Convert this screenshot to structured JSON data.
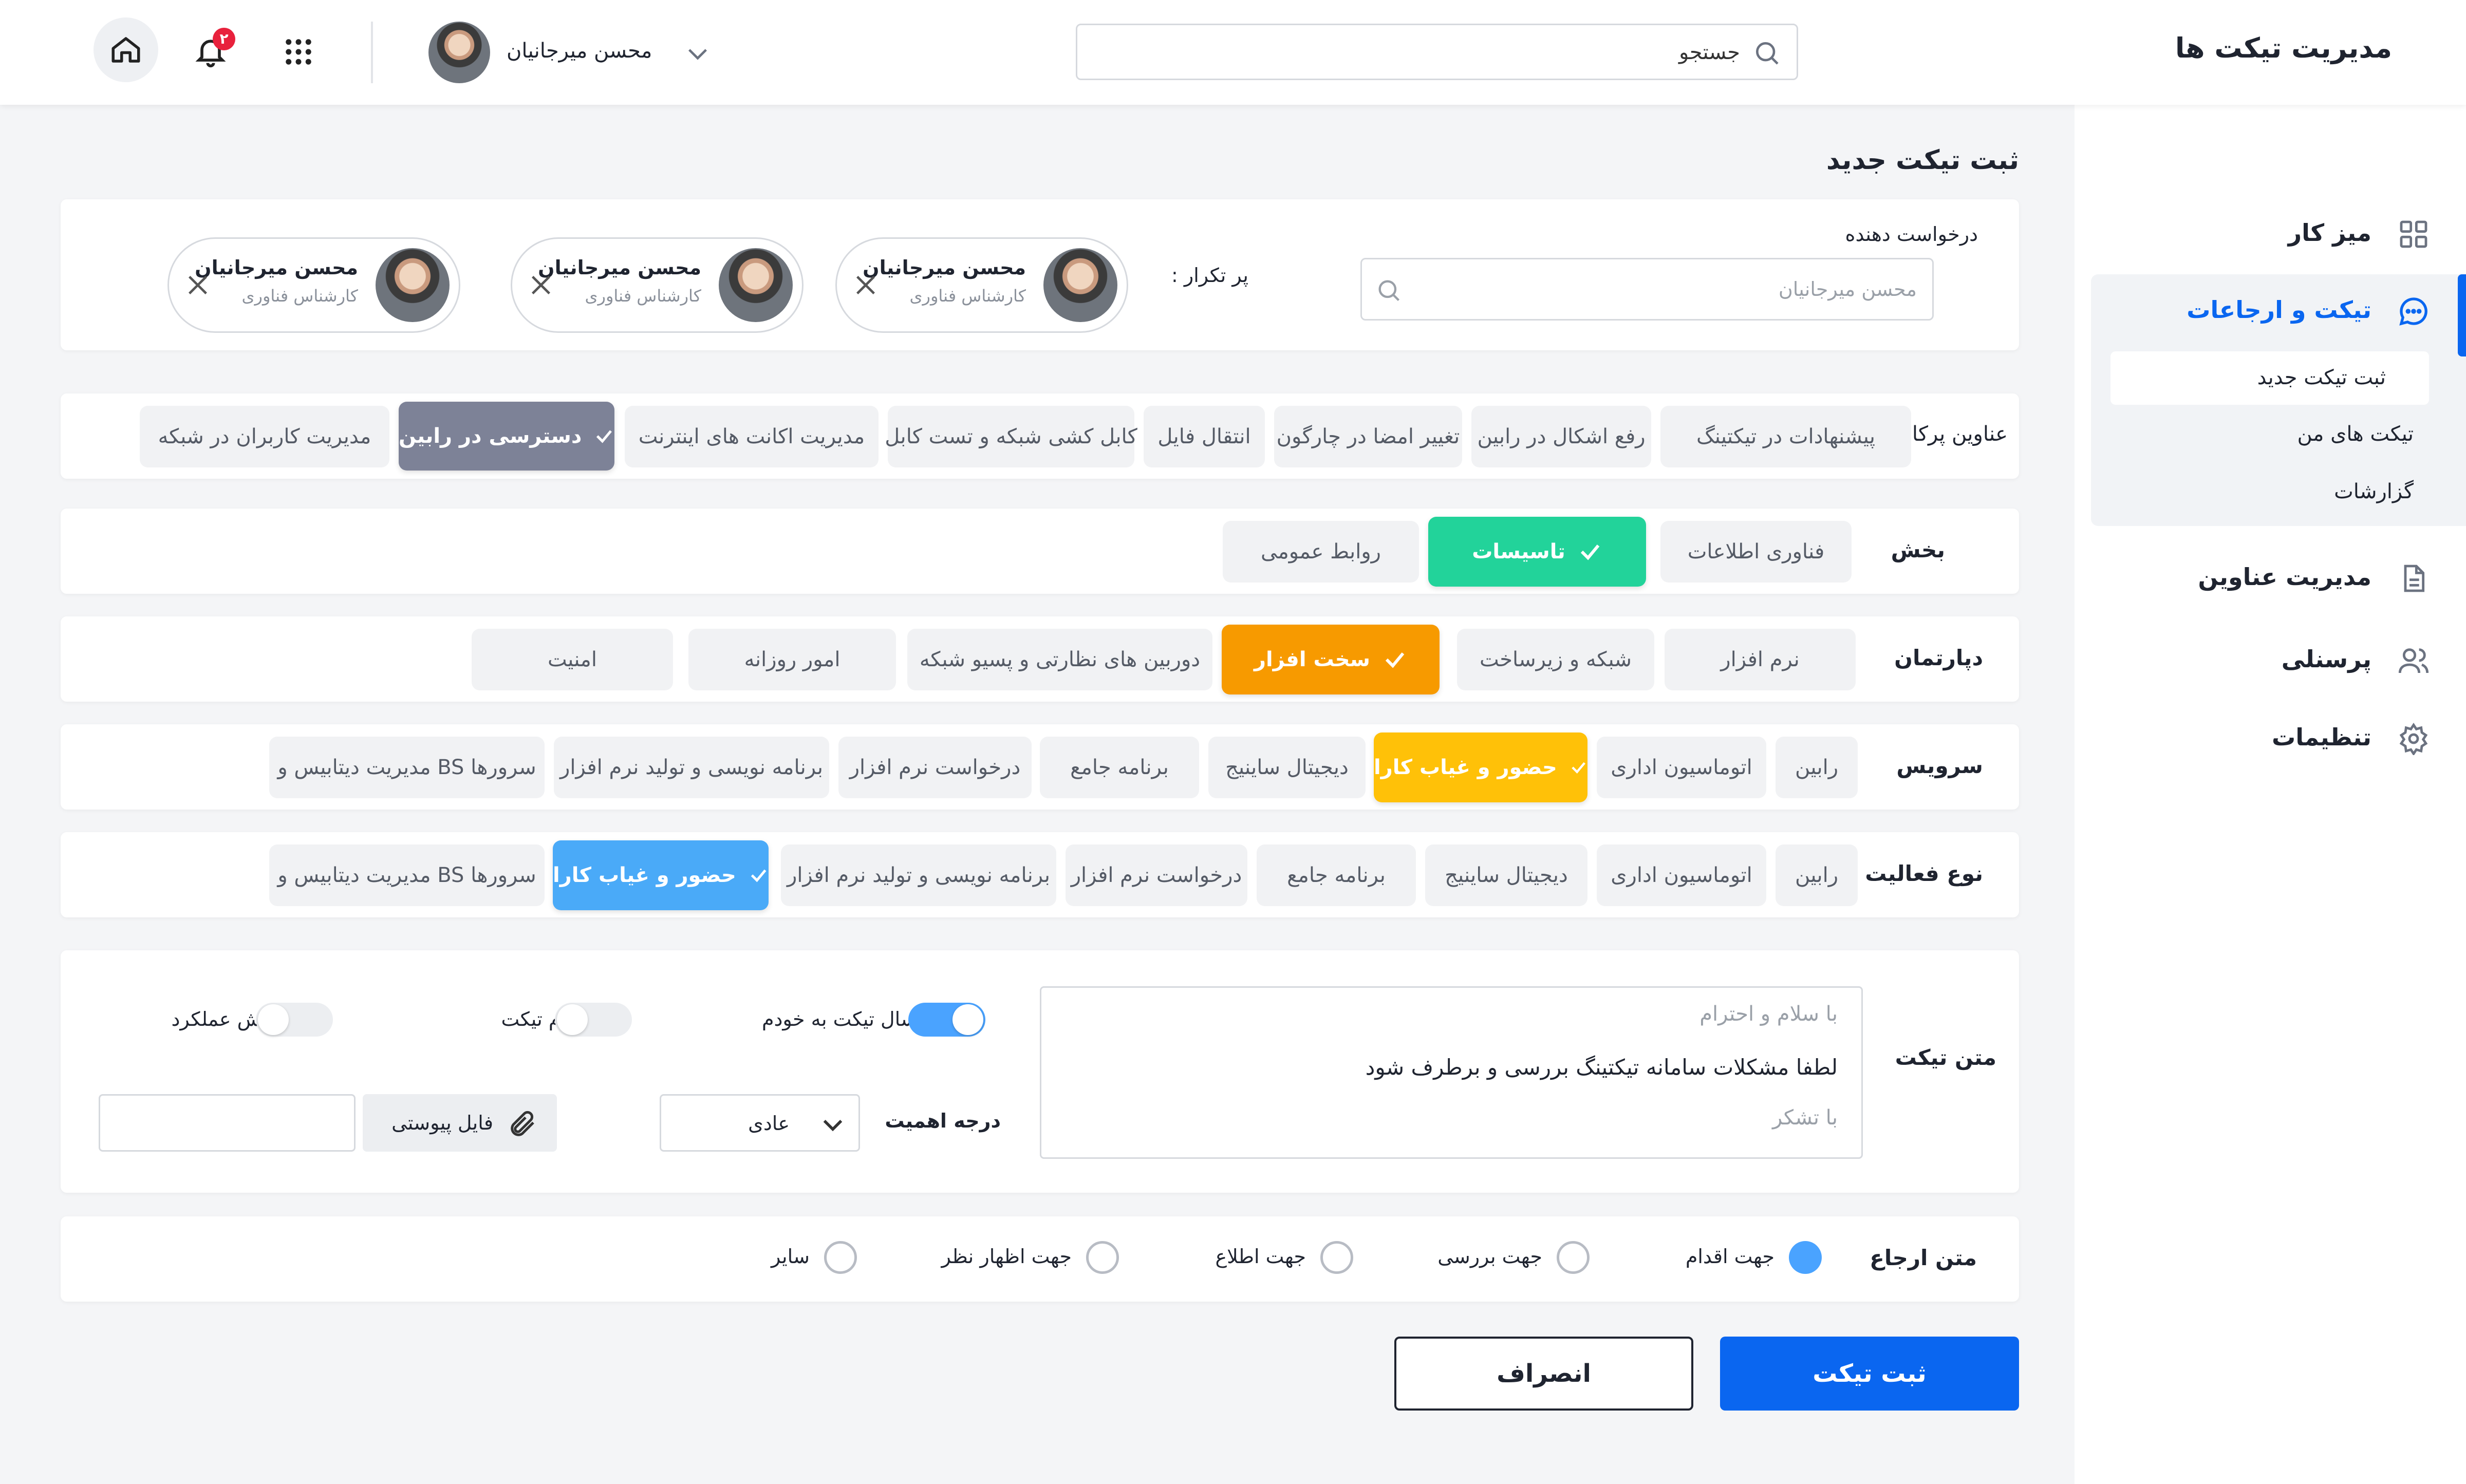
{
  "header": {
    "app_title": "مدیریت تیکت ها",
    "search_placeholder": "جستجو",
    "user_name": "محسن میرجانیان",
    "notification_count": "۲"
  },
  "sidebar": {
    "items": [
      {
        "label": "میز کار",
        "icon": "dashboard-icon"
      },
      {
        "label": "تیکت و ارجاعات",
        "icon": "chat-icon",
        "active": true
      },
      {
        "label": "مدیریت عناوین",
        "icon": "document-icon"
      },
      {
        "label": "پرسنلی",
        "icon": "users-icon"
      },
      {
        "label": "تنظیمات",
        "icon": "gear-icon"
      }
    ],
    "subitems": [
      {
        "label": "ثبت تیکت جدید",
        "active": true
      },
      {
        "label": "تیکت های من"
      },
      {
        "label": "گزارشات"
      }
    ]
  },
  "page_title": "ثبت تیکت جدید",
  "requester": {
    "label": "درخواست دهنده",
    "placeholder": "محسن میرجانیان",
    "frequent_label": "پر تکرار :",
    "people": [
      {
        "name": "محسن میرجانیان",
        "role": "کارشناس فناوری"
      },
      {
        "name": "محسن میرجانیان",
        "role": "کارشناس فناوری"
      },
      {
        "name": "محسن میرجانیان",
        "role": "کارشناس فناوری"
      }
    ]
  },
  "topics": {
    "label": "عناوین پرکاربرد",
    "options": [
      "پیشنهادات در تیکتینگ",
      "رفع اشکال در رابین",
      "تغییر امضا در چارگون",
      "انتقال فایل",
      "کابل کشی شبکه و تست کابل",
      "مدیریت اکانت های اینترنت",
      "دسترسی در رابین",
      "مدیریت کاربران در شبکه"
    ],
    "selected": "دسترسی در رابین"
  },
  "section": {
    "label": "بخش",
    "options": [
      "فناوری اطلاعات",
      "تاسیسات",
      "روابط عمومی"
    ],
    "selected": "تاسیسات"
  },
  "department": {
    "label": "دپارتمان",
    "options": [
      "نرم افزار",
      "شبکه و زیرساخت",
      "سخت افزار",
      "دوربین های نظارتی و  پسیو شبکه",
      "امور روزانه",
      "امنیت"
    ],
    "selected": "سخت افزار"
  },
  "service": {
    "label": "سرویس",
    "options": [
      "رابین",
      "اتوماسیون اداری",
      "حضور و غیاب کارا",
      "دیجیتال ساینیج",
      "برنامه جامع",
      "درخواست نرم افزار",
      "برنامه نویسی و تولید نرم افزار",
      "مدیریت دیتابیس و BS سرورها"
    ],
    "selected": "حضور و غیاب کارا"
  },
  "activity": {
    "label": "نوع فعالیت",
    "options": [
      "رابین",
      "اتوماسیون اداری",
      "دیجیتال ساینیج",
      "برنامه جامع",
      "درخواست نرم افزار",
      "برنامه نویسی و تولید نرم افزار",
      "حضور و غیاب کارا",
      "مدیریت دیتابیس و BS سرورها"
    ],
    "selected": "حضور و غیاب کارا"
  },
  "ticket_text": {
    "label": "متن تیکت",
    "line1": "با سلام و احترام",
    "line2": "لطفا مشکلات سامانه تیکتینگ بررسی و برطرف شود",
    "line3": "با تشکر"
  },
  "toggles": [
    {
      "label": "ارسال تیکت به خودم",
      "on": true
    },
    {
      "label": "اختتام تیکت",
      "on": false
    },
    {
      "label": "گزارش عملکرد",
      "on": false
    }
  ],
  "priority": {
    "label": "درجه اهمیت",
    "value": "عادی"
  },
  "attachment": {
    "button_label": "فایل پیوستی",
    "value": ""
  },
  "referral": {
    "label": "متن ارجاع",
    "options": [
      "جهت اقدام",
      "جهت بررسی",
      "جهت اطلاع",
      "جهت اظهار نظر",
      "سایر"
    ],
    "selected": "جهت اقدام"
  },
  "actions": {
    "submit": "ثبت تیکت",
    "cancel": "انصراف"
  },
  "colors": {
    "primary": "#0a66f0",
    "topic_selected": "#7d8297",
    "section_selected": "#22d39a",
    "department_selected": "#f79a00",
    "service_selected": "#ffc108",
    "activity_selected": "#4aaaf8",
    "toggle_on": "#4aa3ff"
  }
}
